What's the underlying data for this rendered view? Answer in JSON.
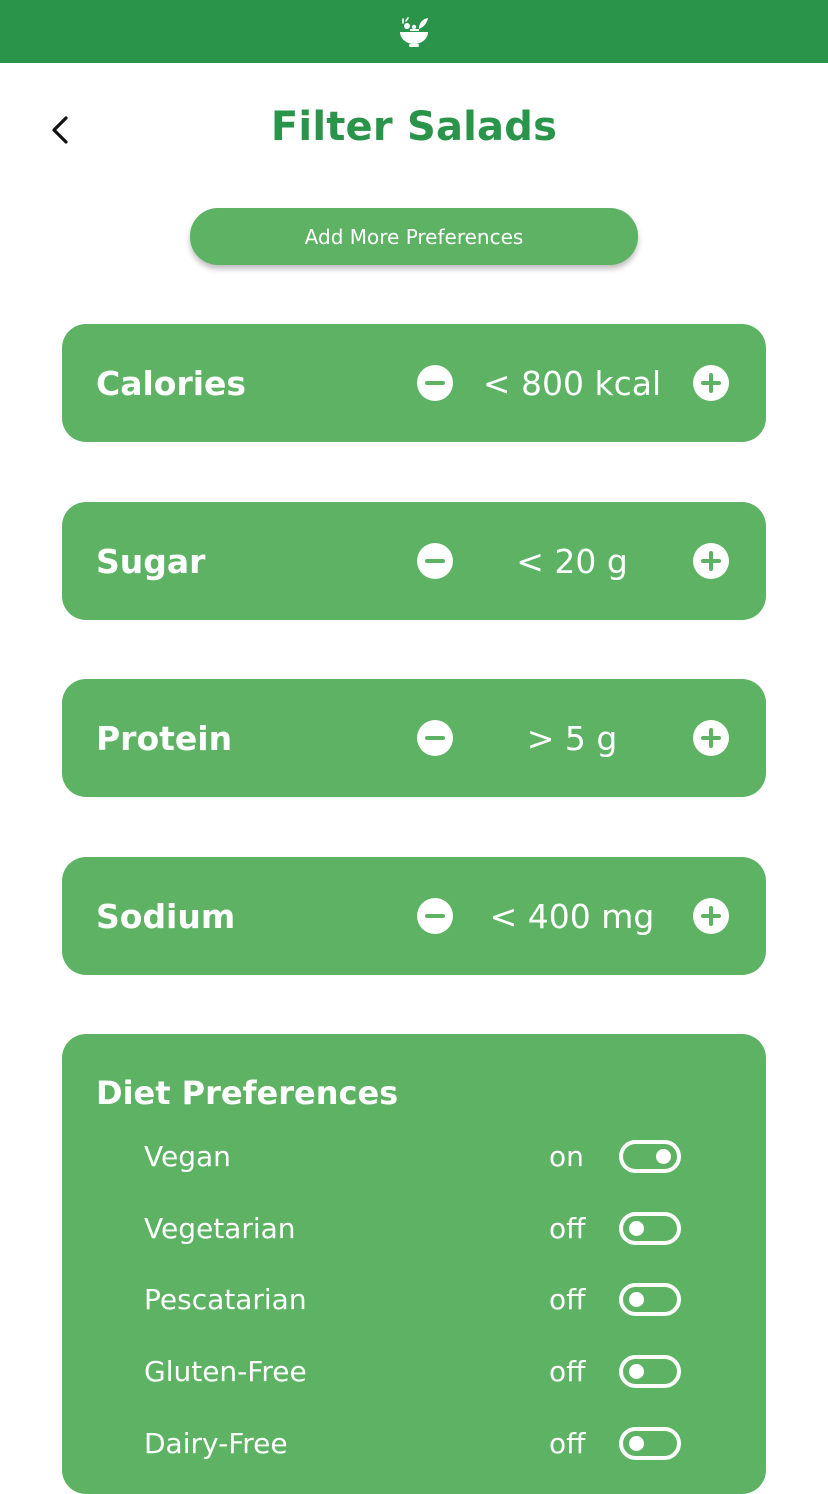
{
  "header": {
    "logo_icon": "salad-bowl-icon",
    "title": "Filter Salads",
    "back_icon": "chevron-left-icon"
  },
  "add_preferences_label": "Add More Preferences",
  "nutrients": [
    {
      "label": "Calories",
      "value": "< 800 kcal"
    },
    {
      "label": "Sugar",
      "value": "< 20 g"
    },
    {
      "label": "Protein",
      "value": "> 5 g"
    },
    {
      "label": "Sodium",
      "value": "< 400 mg"
    }
  ],
  "diet": {
    "title": "Diet Preferences",
    "items": [
      {
        "label": "Vegan",
        "state": "on"
      },
      {
        "label": "Vegetarian",
        "state": "off"
      },
      {
        "label": "Pescatarian",
        "state": "off"
      },
      {
        "label": "Gluten-Free",
        "state": "off"
      },
      {
        "label": "Dairy-Free",
        "state": "off"
      }
    ]
  },
  "colors": {
    "top_bar": "#2b944b",
    "title": "#2b944b",
    "card": "#5db363",
    "text_on_card": "#ffffff"
  }
}
